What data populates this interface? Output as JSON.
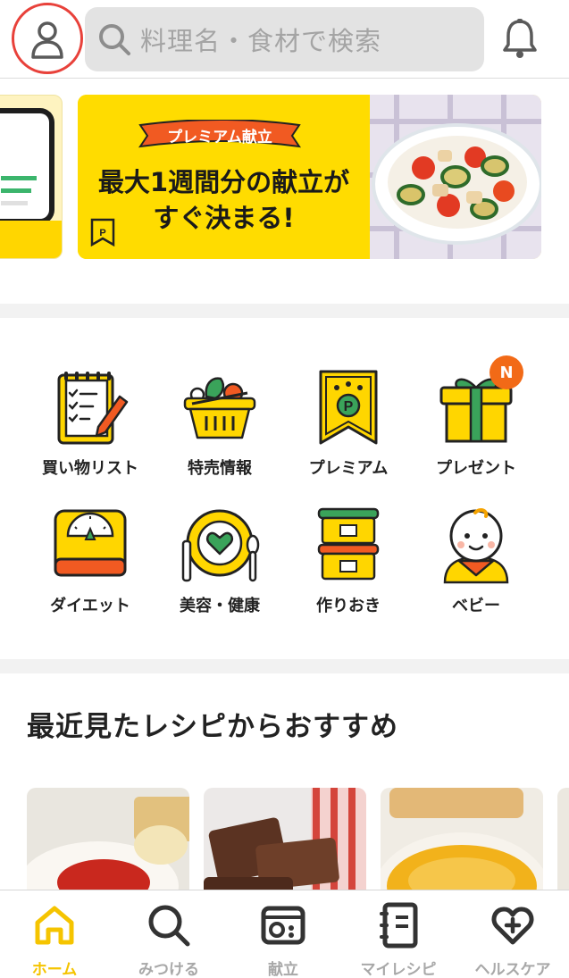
{
  "header": {
    "search_placeholder": "料理名・食材で検索"
  },
  "banner": {
    "ribbon": "プレミアム献立",
    "title_line1": "最大1週間分の献立が",
    "title_line2": "すぐ決まる!"
  },
  "services": [
    {
      "label": "買い物リスト",
      "icon": "shopping-list-icon"
    },
    {
      "label": "特売情報",
      "icon": "sale-basket-icon"
    },
    {
      "label": "プレミアム",
      "icon": "premium-flag-icon"
    },
    {
      "label": "プレゼント",
      "icon": "gift-icon",
      "badge": "N"
    },
    {
      "label": "ダイエット",
      "icon": "scale-icon"
    },
    {
      "label": "美容・健康",
      "icon": "plate-heart-icon"
    },
    {
      "label": "作りおき",
      "icon": "container-icon"
    },
    {
      "label": "ベビー",
      "icon": "baby-icon"
    }
  ],
  "recommend": {
    "title": "最近見たレシピからおすすめ"
  },
  "tabbar": {
    "items": [
      {
        "label": "ホーム",
        "icon": "home-icon",
        "active": true
      },
      {
        "label": "みつける",
        "icon": "search-icon",
        "active": false
      },
      {
        "label": "献立",
        "icon": "menu-plan-icon",
        "active": false
      },
      {
        "label": "マイレシピ",
        "icon": "notebook-icon",
        "active": false
      },
      {
        "label": "ヘルスケア",
        "icon": "heart-plus-icon",
        "active": false
      }
    ]
  },
  "colors": {
    "accent_yellow": "#ffdc00",
    "highlight_red": "#e8413a",
    "badge_orange": "#f26a17",
    "tab_active": "#f5c400",
    "tab_inactive": "#a8a8a8"
  }
}
